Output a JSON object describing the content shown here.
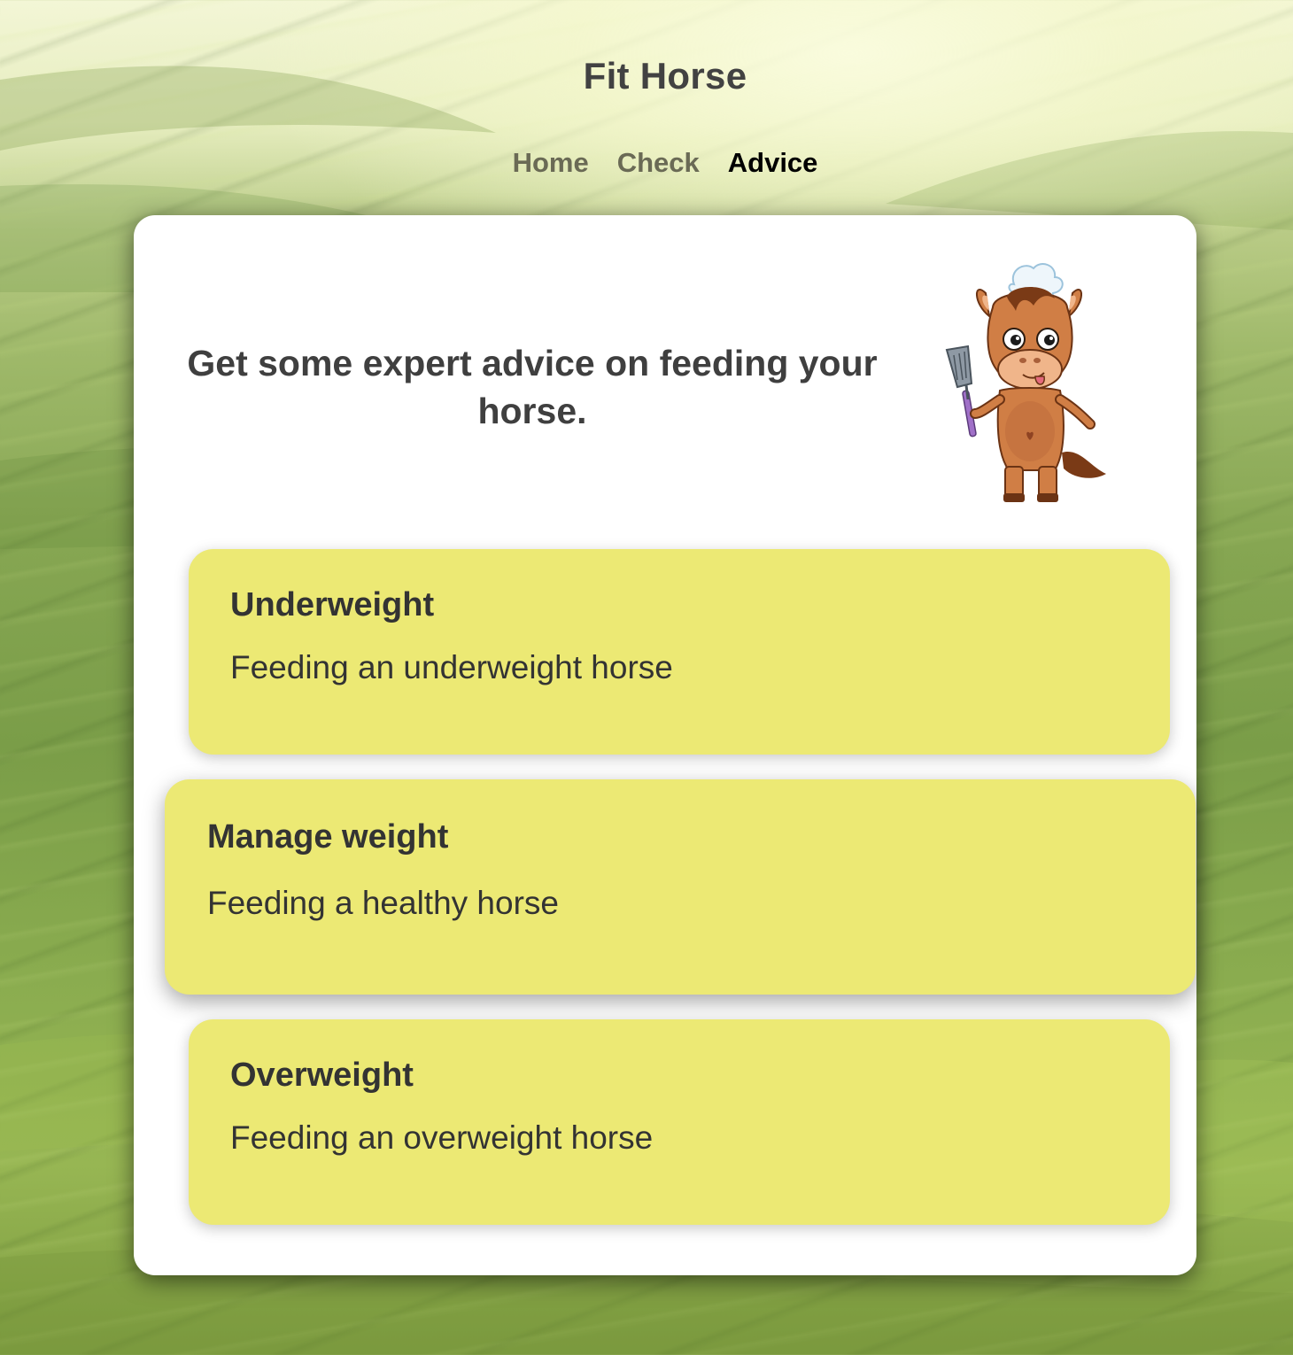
{
  "header": {
    "title": "Fit Horse"
  },
  "nav": {
    "items": [
      {
        "label": "Home"
      },
      {
        "label": "Check"
      },
      {
        "label": "Advice"
      }
    ],
    "active": "Advice"
  },
  "main": {
    "headline": "Get some expert advice on feeding your horse.",
    "mascot": "chef-horse-illustration",
    "options": [
      {
        "title": "Underweight",
        "description": "Feeding an underweight horse"
      },
      {
        "title": "Manage weight",
        "description": "Feeding a healthy horse"
      },
      {
        "title": "Overweight",
        "description": "Feeding an overweight horse"
      }
    ]
  },
  "colors": {
    "card_bg": "#ffffff",
    "option_bg": "#ece974",
    "nav_inactive": "#6a6a55",
    "nav_active": "#000000",
    "text": "#3f3f3f"
  }
}
